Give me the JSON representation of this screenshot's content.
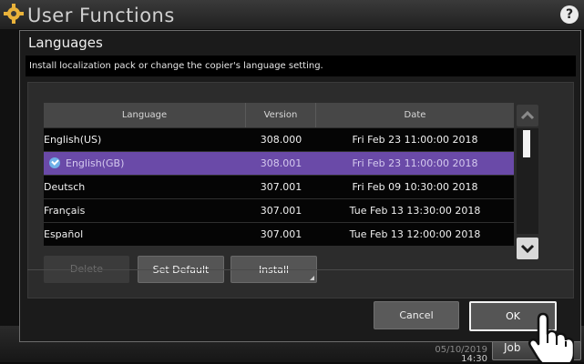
{
  "app": {
    "title": "User Functions",
    "clock_date": "05/10/2019",
    "clock_time": "14:30",
    "job_button": "Job"
  },
  "dialog": {
    "title": "Languages",
    "instruction": "Install localization pack or change the copier's language setting.",
    "columns": {
      "language": "Language",
      "version": "Version",
      "date": "Date"
    },
    "rows": [
      {
        "language": "English(US)",
        "version": "308.000",
        "date": "Fri Feb 23 11:00:00 2018",
        "selected": false
      },
      {
        "language": "English(GB)",
        "version": "308.001",
        "date": "Fri Feb 23 11:00:00 2018",
        "selected": true
      },
      {
        "language": "Deutsch",
        "version": "307.001",
        "date": "Fri Feb 09 10:30:00 2018",
        "selected": false
      },
      {
        "language": "Français",
        "version": "307.001",
        "date": "Tue Feb 13 13:30:00 2018",
        "selected": false
      },
      {
        "language": "Español",
        "version": "307.001",
        "date": "Tue Feb 13 12:00:00 2018",
        "selected": false
      }
    ],
    "buttons": {
      "delete": "Delete",
      "set_default": "Set Default",
      "install": "Install",
      "cancel": "Cancel",
      "ok": "OK"
    }
  },
  "colors": {
    "selected_row": "#6a4aa8",
    "check": "#6fb0e8"
  }
}
